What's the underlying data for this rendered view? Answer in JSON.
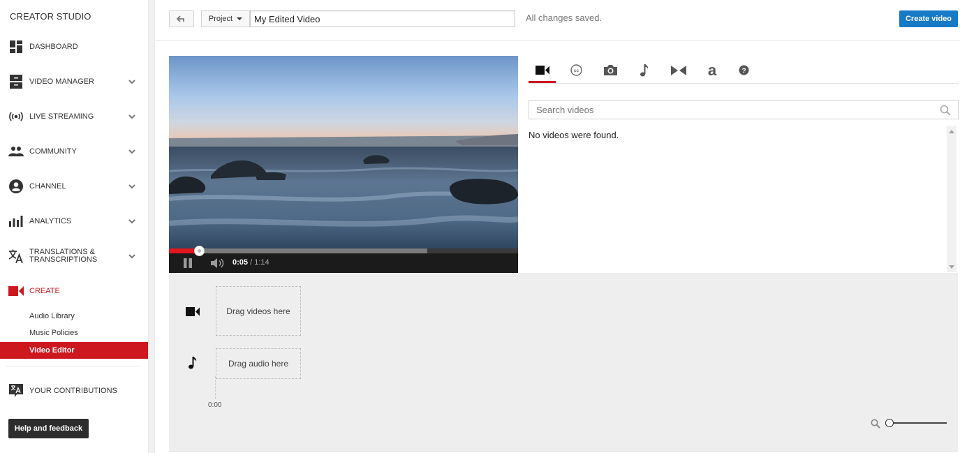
{
  "sidebar": {
    "brand": "CREATOR STUDIO",
    "items": [
      {
        "label": "DASHBOARD",
        "icon": "dashboard-icon",
        "expandable": false
      },
      {
        "label": "VIDEO MANAGER",
        "icon": "video-manager-icon",
        "expandable": true
      },
      {
        "label": "LIVE STREAMING",
        "icon": "live-streaming-icon",
        "expandable": true
      },
      {
        "label": "COMMUNITY",
        "icon": "community-icon",
        "expandable": true
      },
      {
        "label": "CHANNEL",
        "icon": "channel-icon",
        "expandable": true
      },
      {
        "label": "ANALYTICS",
        "icon": "analytics-icon",
        "expandable": true
      },
      {
        "label_line1": "TRANSLATIONS &",
        "label_line2": "TRANSCRIPTIONS",
        "icon": "translate-icon",
        "expandable": true
      },
      {
        "label": "CREATE",
        "icon": "create-camera-icon",
        "expandable": false,
        "active": true
      }
    ],
    "create_subitems": [
      {
        "label": "Audio Library"
      },
      {
        "label": "Music Policies"
      },
      {
        "label": "Video Editor",
        "selected": true
      }
    ],
    "contributions": {
      "label": "YOUR CONTRIBUTIONS",
      "icon": "contributions-icon"
    },
    "help_button": "Help and feedback"
  },
  "topbar": {
    "back_icon": "back-arrow-icon",
    "project_menu": "Project",
    "title_value": "My Edited Video",
    "status": "All changes saved.",
    "create_button": "Create video"
  },
  "player": {
    "current_time": "0:05",
    "separator": " / ",
    "duration": "1:14",
    "played_fraction": 0.087,
    "buffered_fraction": 0.74,
    "state": "playing"
  },
  "media_tabs": [
    {
      "name": "videos",
      "icon": "video-camera-icon",
      "active": true
    },
    {
      "name": "captions",
      "icon": "cc-icon"
    },
    {
      "name": "photos",
      "icon": "camera-icon"
    },
    {
      "name": "audio",
      "icon": "music-note-icon"
    },
    {
      "name": "transitions",
      "icon": "transitions-icon"
    },
    {
      "name": "text",
      "icon": "text-icon"
    },
    {
      "name": "help",
      "icon": "help-icon"
    }
  ],
  "search": {
    "placeholder": "Search videos",
    "value": ""
  },
  "results": {
    "empty_message": "No videos were found."
  },
  "timeline": {
    "video_drop": "Drag videos here",
    "audio_drop": "Drag audio here",
    "start_time": "0:00",
    "zoom_level": 0
  },
  "colors": {
    "accent_red": "#cc181e",
    "primary_blue": "#167ac6",
    "progress_red": "#e1181e"
  }
}
